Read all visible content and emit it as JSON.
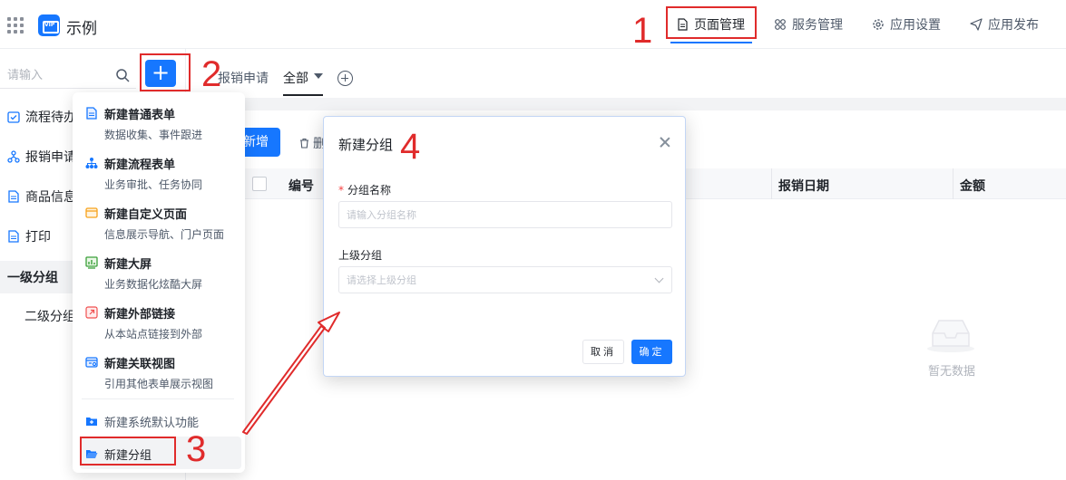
{
  "header": {
    "app_title": "示例",
    "logo_text": "VIP",
    "nav": {
      "page": "页面管理",
      "service": "服务管理",
      "settings": "应用设置",
      "publish": "应用发布"
    }
  },
  "sidebar": {
    "search_placeholder": "请输入",
    "add_label": "+",
    "items": [
      "流程待办",
      "报销申请",
      "商品信息",
      "打印"
    ],
    "group": "一级分组",
    "subgroup": "二级分组"
  },
  "tabs": {
    "items": [
      "报销申请",
      "全部"
    ],
    "active": "全部"
  },
  "toolbar": {
    "new_label": "新增",
    "delete_label": "删"
  },
  "table": {
    "columns": [
      "编号",
      "报销日期",
      "金额"
    ],
    "empty_text": "暂无数据"
  },
  "menu": {
    "items": [
      {
        "title": "新建普通表单",
        "desc": "数据收集、事件跟进"
      },
      {
        "title": "新建流程表单",
        "desc": "业务审批、任务协同"
      },
      {
        "title": "新建自定义页面",
        "desc": "信息展示导航、门户页面"
      },
      {
        "title": "新建大屏",
        "desc": "业务数据化炫酷大屏"
      },
      {
        "title": "新建外部链接",
        "desc": "从本站点链接到外部"
      },
      {
        "title": "新建关联视图",
        "desc": "引用其他表单展示视图"
      }
    ],
    "system_default": "新建系统默认功能",
    "new_group": "新建分组"
  },
  "dialog": {
    "title": "新建分组",
    "name_label": "分组名称",
    "name_required": "*",
    "name_placeholder": "请输入分组名称",
    "parent_label": "上级分组",
    "parent_placeholder": "请选择上级分组",
    "cancel": "取消",
    "ok": "确定"
  },
  "annotations": [
    "1",
    "2",
    "3",
    "4"
  ],
  "colors": {
    "accent": "#1677ff",
    "annotation": "#e02b2b"
  }
}
